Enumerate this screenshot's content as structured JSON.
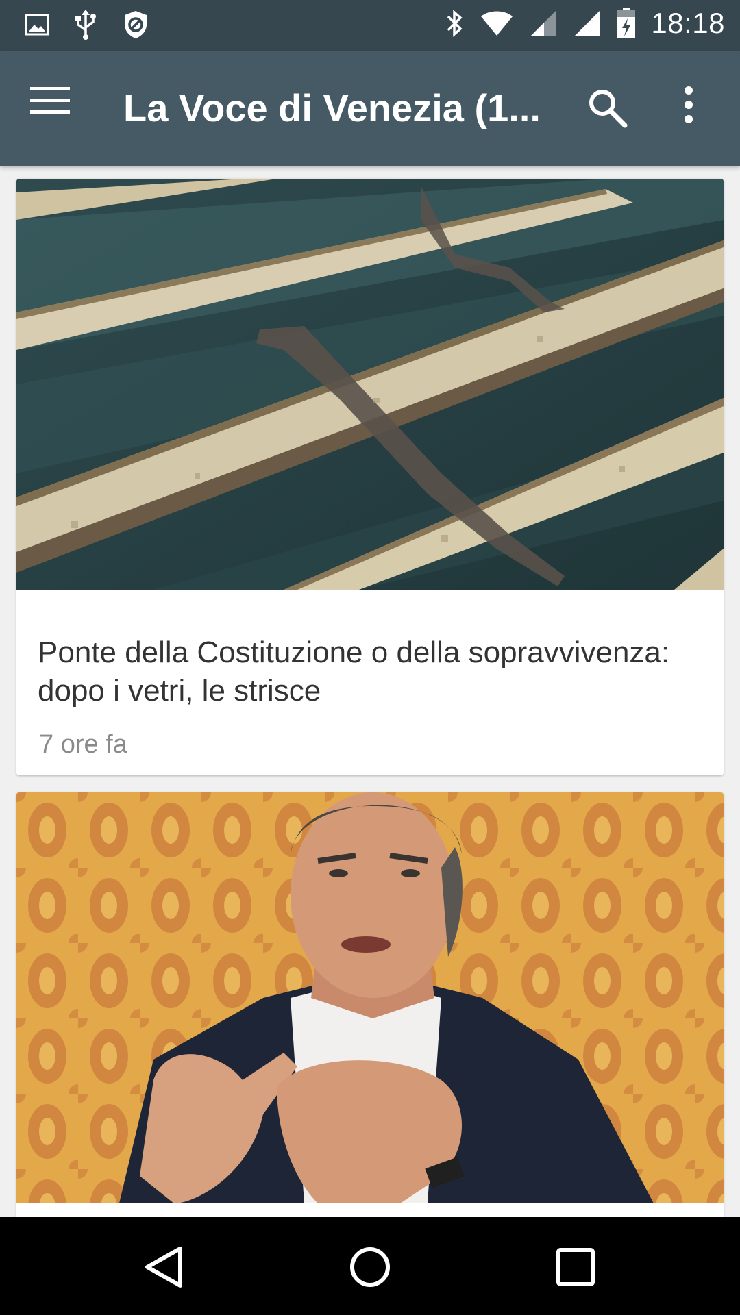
{
  "status_bar": {
    "time": "18:18",
    "icons": [
      "image-icon",
      "usb-icon",
      "block-icon",
      "bluetooth-icon",
      "wifi-icon",
      "signal-icon",
      "signal-full-icon",
      "battery-charging-icon"
    ]
  },
  "app_bar": {
    "title": "La Voce di Venezia (1...",
    "icons": [
      "menu-icon",
      "search-icon",
      "more-vert-icon"
    ]
  },
  "feed": {
    "articles": [
      {
        "title": "Ponte della Costituzione o della sopravvivenza: dopo i vetri, le strisce",
        "time": "7 ore fa"
      }
    ]
  },
  "nav_bar": {
    "icons": [
      "back-icon",
      "home-icon",
      "recents-icon"
    ]
  },
  "colors": {
    "status_bar": "#37474f",
    "app_bar": "#455a64",
    "background": "#f0f0f0",
    "card": "#ffffff"
  }
}
